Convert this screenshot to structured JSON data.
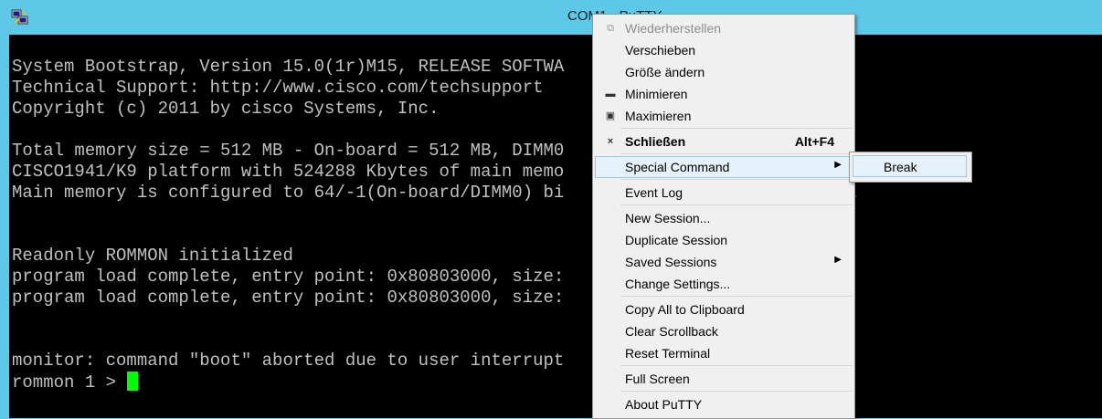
{
  "window": {
    "title": "COM1 - PuTTY",
    "icon": "putty-icon"
  },
  "terminal": {
    "lines": [
      "",
      "System Bootstrap, Version 15.0(1r)M15, RELEASE SOFTWA",
      "Technical Support: http://www.cisco.com/techsupport",
      "Copyright (c) 2011 by cisco Systems, Inc.",
      "",
      "Total memory size = 512 MB - On-board = 512 MB, DIMM0",
      "CISCO1941/K9 platform with 524288 Kbytes of main memo",
      "Main memory is configured to 64/-1(On-board/DIMM0) bi",
      "",
      "",
      "Readonly ROMMON initialized",
      "program load complete, entry point: 0x80803000, size:",
      "program load complete, entry point: 0x80803000, size:",
      "",
      "",
      "monitor: command \"boot\" aborted due to user interrupt",
      "rommon 1 > "
    ],
    "overflow_fragment": "1",
    "cursor_color": "#00ff00"
  },
  "menu": {
    "restore": "Wiederherstellen",
    "move": "Verschieben",
    "size": "Größe ändern",
    "minimize": "Minimieren",
    "maximize": "Maximieren",
    "close": "Schließen",
    "close_shortcut": "Alt+F4",
    "special_command": "Special Command",
    "event_log": "Event Log",
    "new_session": "New Session...",
    "duplicate_session": "Duplicate Session",
    "saved_sessions": "Saved Sessions",
    "change_settings": "Change Settings...",
    "copy_all": "Copy All to Clipboard",
    "clear_scrollback": "Clear Scrollback",
    "reset_terminal": "Reset Terminal",
    "full_screen": "Full Screen",
    "about": "About PuTTY"
  },
  "submenu": {
    "break": "Break"
  },
  "colors": {
    "titlebar": "#5ec8e9",
    "terminal_bg": "#000000",
    "terminal_fg": "#c0c0c0",
    "highlight": "#e5f1fb"
  }
}
